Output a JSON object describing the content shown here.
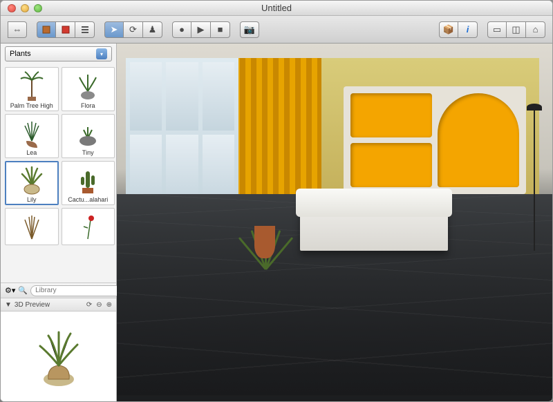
{
  "window": {
    "title": "Untitled"
  },
  "toolbar": {
    "groups": {
      "a": [
        "layout-toggle-icon"
      ],
      "b": [
        "library-icon",
        "materials-icon",
        "list-view-icon"
      ],
      "c": [
        "arrow-icon",
        "rotate-icon",
        "walk-icon"
      ],
      "d": [
        "record-icon",
        "play-icon",
        "stop-icon"
      ],
      "e": [
        "camera-icon"
      ],
      "r1": [
        "package-icon",
        "info-icon"
      ],
      "r2": [
        "view-2d-icon",
        "view-split-icon",
        "view-3d-icon"
      ]
    }
  },
  "sidebar": {
    "category": "Plants",
    "items": [
      {
        "label": "Palm Tree High",
        "kind": "palm"
      },
      {
        "label": "Flora",
        "kind": "flora"
      },
      {
        "label": "Lea",
        "kind": "lea"
      },
      {
        "label": "Tiny",
        "kind": "tiny"
      },
      {
        "label": "Lily",
        "kind": "lily",
        "selected": true
      },
      {
        "label": "Cactu...alahari",
        "kind": "cactus"
      },
      {
        "label": "",
        "kind": "grass"
      },
      {
        "label": "",
        "kind": "rose"
      }
    ],
    "search_placeholder": "Library",
    "preview_title": "3D Preview"
  }
}
